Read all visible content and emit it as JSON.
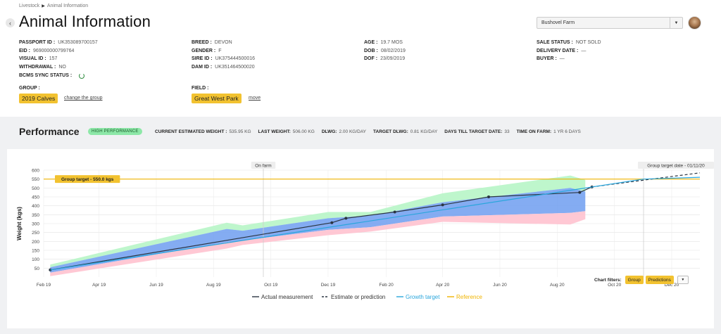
{
  "breadcrumb": {
    "root": "Livestock",
    "sep": "▶",
    "current": "Animal Information"
  },
  "page_title": "Animal Information",
  "back_icon": "chevron-left-icon",
  "farm_selector": {
    "value": "Bushovel Farm",
    "icon": "chevron-down-icon"
  },
  "info": {
    "col1": [
      {
        "label": "PASSPORT ID :",
        "value": "UK353089700157"
      },
      {
        "label": "EID :",
        "value": "969000000799764"
      },
      {
        "label": "VISUAL ID :",
        "value": "157"
      },
      {
        "label": "WITHDRAWAL :",
        "value": "NO"
      },
      {
        "label": "BCMS SYNC STATUS :",
        "value": ""
      }
    ],
    "col2": [
      {
        "label": "BREED :",
        "value": "DEVON"
      },
      {
        "label": "GENDER :",
        "value": "F"
      },
      {
        "label": "SIRE ID :",
        "value": "UK375444500016"
      },
      {
        "label": "DAM ID :",
        "value": "UK351464500020"
      }
    ],
    "col3": [
      {
        "label": "AGE :",
        "value": "19.7 MOS"
      },
      {
        "label": "DOB :",
        "value": "08/02/2019"
      },
      {
        "label": "DOF :",
        "value": "23/09/2019"
      }
    ],
    "col4": [
      {
        "label": "SALE STATUS :",
        "value": "NOT SOLD"
      },
      {
        "label": "DELIVERY DATE :",
        "value": "—"
      },
      {
        "label": "BUYER :",
        "value": "—"
      }
    ]
  },
  "group": {
    "label": "GROUP :",
    "value": "2019 Calves",
    "link": "change the group"
  },
  "field": {
    "label": "FIELD :",
    "value": "Great West Park",
    "link": "move"
  },
  "performance": {
    "title": "Performance",
    "badge": "HIGH PERFORMANCE",
    "stats": [
      {
        "label": "CURRENT ESTIMATED WEIGHT :",
        "value": "535.95 KG"
      },
      {
        "label": "LAST WEIGHT:",
        "value": "506.00 KG"
      },
      {
        "label": "DLWG:",
        "value": "2.00 KG/DAY"
      },
      {
        "label": "TARGET DLWG:",
        "value": "0.81 KG/DAY"
      },
      {
        "label": "DAYS TILL TARGET DATE:",
        "value": "33"
      },
      {
        "label": "TIME ON FARM:",
        "value": "1 YR 6 DAYS"
      }
    ]
  },
  "filters": {
    "label": "Chart filters:",
    "buttons": [
      "Group",
      "Predictions"
    ],
    "dropdown_icon": "chevron-down-icon"
  },
  "colors": {
    "accent": "#f2c230",
    "actual": "#2b3542",
    "growth": "#2aa6dc",
    "reference": "#f0b400",
    "band_green": "#b7f5c6",
    "band_blue": "#6f9ef0",
    "band_pink": "#ffc2cf"
  },
  "chart_data": {
    "type": "line",
    "ylabel": "Weight (kgs)",
    "xlabel": "",
    "ylim": [
      0,
      600
    ],
    "yticks": [
      50,
      100,
      150,
      200,
      250,
      300,
      350,
      400,
      450,
      500,
      550,
      600
    ],
    "x_start": "2019-02-01",
    "x_end": "2020-12-31",
    "xticks": [
      {
        "date": "2019-02-01",
        "label": "Feb 19"
      },
      {
        "date": "2019-04-01",
        "label": "Apr 19"
      },
      {
        "date": "2019-06-01",
        "label": "Jun 19"
      },
      {
        "date": "2019-08-01",
        "label": "Aug 19"
      },
      {
        "date": "2019-10-01",
        "label": "Oct 19"
      },
      {
        "date": "2019-12-01",
        "label": "Dec 19"
      },
      {
        "date": "2020-02-01",
        "label": "Feb 20"
      },
      {
        "date": "2020-04-01",
        "label": "Apr 20"
      },
      {
        "date": "2020-06-01",
        "label": "Jun 20"
      },
      {
        "date": "2020-08-01",
        "label": "Aug 20"
      },
      {
        "date": "2020-10-01",
        "label": "Oct 20"
      },
      {
        "date": "2020-12-01",
        "label": "Dec 20"
      }
    ],
    "vlines": [
      {
        "date": "2019-09-23",
        "label": "On farm"
      },
      {
        "date": "2020-11-01",
        "label": "Group target date - 01/11/20"
      }
    ],
    "hline": {
      "value": 550,
      "label": "Group target - 550.0 kgs"
    },
    "series": [
      {
        "name": "Actual measurement",
        "style": "solid",
        "points": [
          [
            "2019-02-08",
            40
          ],
          [
            "2019-12-05",
            305
          ],
          [
            "2019-12-20",
            330
          ],
          [
            "2020-02-10",
            365
          ],
          [
            "2020-04-01",
            405
          ],
          [
            "2020-05-20",
            450
          ],
          [
            "2020-08-25",
            475
          ],
          [
            "2020-09-07",
            506
          ]
        ]
      },
      {
        "name": "Estimate or prediction",
        "style": "dashed",
        "points": [
          [
            "2020-09-07",
            506
          ],
          [
            "2020-12-31",
            585
          ]
        ]
      },
      {
        "name": "Growth target",
        "style": "solid",
        "points": [
          [
            "2019-02-08",
            40
          ],
          [
            "2020-11-01",
            550
          ],
          [
            "2020-12-31",
            560
          ]
        ]
      },
      {
        "name": "Reference",
        "style": "solid",
        "points": []
      }
    ],
    "bands": [
      {
        "name": "high",
        "points": [
          [
            "2019-02-08",
            70
          ],
          [
            "2019-08-15",
            305
          ],
          [
            "2019-09-01",
            290
          ],
          [
            "2019-12-01",
            365
          ],
          [
            "2020-01-15",
            365
          ],
          [
            "2020-04-01",
            470
          ],
          [
            "2020-08-15",
            570
          ],
          [
            "2020-08-31",
            545
          ],
          [
            "2020-08-31",
            480
          ],
          [
            "2020-08-15",
            500
          ],
          [
            "2020-04-01",
            420
          ],
          [
            "2020-01-15",
            345
          ],
          [
            "2019-12-01",
            330
          ],
          [
            "2019-09-01",
            260
          ],
          [
            "2019-08-15",
            270
          ],
          [
            "2019-02-08",
            55
          ]
        ]
      },
      {
        "name": "mid",
        "points": [
          [
            "2019-02-08",
            55
          ],
          [
            "2019-08-15",
            270
          ],
          [
            "2019-09-01",
            260
          ],
          [
            "2019-12-01",
            330
          ],
          [
            "2020-01-15",
            345
          ],
          [
            "2020-04-01",
            420
          ],
          [
            "2020-08-15",
            500
          ],
          [
            "2020-08-31",
            480
          ],
          [
            "2020-08-31",
            370
          ],
          [
            "2020-08-15",
            360
          ],
          [
            "2020-04-01",
            340
          ],
          [
            "2020-01-15",
            280
          ],
          [
            "2019-12-01",
            265
          ],
          [
            "2019-09-01",
            205
          ],
          [
            "2019-08-15",
            195
          ],
          [
            "2019-02-08",
            25
          ]
        ]
      },
      {
        "name": "low",
        "points": [
          [
            "2019-02-08",
            25
          ],
          [
            "2019-08-15",
            195
          ],
          [
            "2019-09-01",
            205
          ],
          [
            "2019-12-01",
            265
          ],
          [
            "2020-01-15",
            280
          ],
          [
            "2020-04-01",
            340
          ],
          [
            "2020-08-15",
            360
          ],
          [
            "2020-08-31",
            370
          ],
          [
            "2020-08-31",
            325
          ],
          [
            "2020-08-15",
            295
          ],
          [
            "2020-04-01",
            310
          ],
          [
            "2020-01-15",
            255
          ],
          [
            "2019-12-01",
            235
          ],
          [
            "2019-09-01",
            180
          ],
          [
            "2019-08-15",
            160
          ],
          [
            "2019-02-08",
            5
          ]
        ]
      }
    ],
    "legend": [
      "Actual measurement",
      "Estimate or prediction",
      "Growth target",
      "Reference"
    ],
    "grid": true,
    "legend_position": "bottom"
  }
}
